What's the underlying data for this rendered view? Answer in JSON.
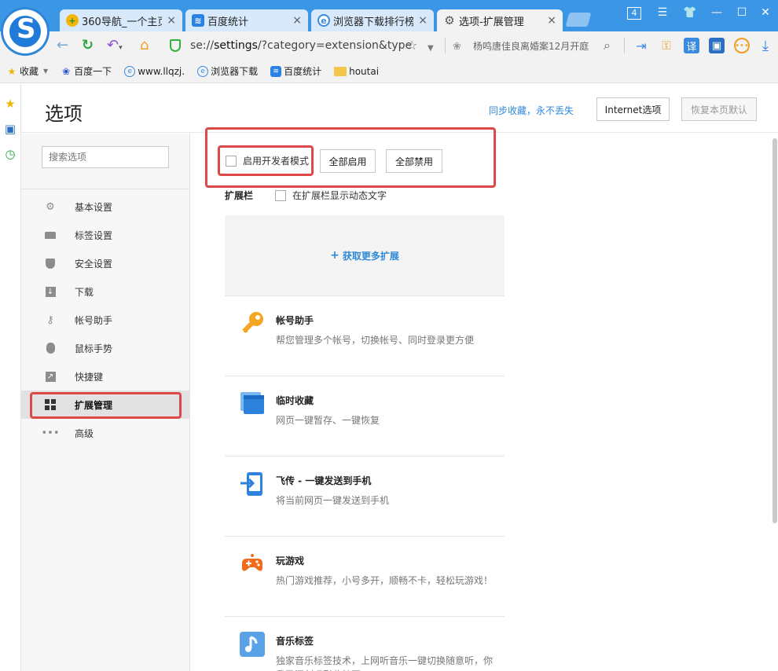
{
  "tabs": [
    {
      "label": "360导航_一个主页",
      "icon": "360-nav-icon",
      "close": "×"
    },
    {
      "label": "百度统计",
      "icon": "baidu-stats-icon",
      "close": "×"
    },
    {
      "label": "浏览器下载排行榜",
      "icon": "browser-download-icon",
      "close": "×"
    },
    {
      "label": "选项-扩展管理",
      "icon": "gear-icon",
      "close": "×"
    }
  ],
  "window": {
    "tab_count": "4"
  },
  "address": {
    "prefix": "se://",
    "bold": "settings",
    "rest": "/?category=extension&type"
  },
  "search_hint": "杨鸣唐佳良离婚案12月开庭",
  "bookmarks": [
    {
      "label": "收藏",
      "icon": "star-icon"
    },
    {
      "label": "百度一下",
      "icon": "baidu-paw-icon"
    },
    {
      "label": "www.llqzj.",
      "icon": "ie-icon"
    },
    {
      "label": "浏览器下载",
      "icon": "ie-icon"
    },
    {
      "label": "百度统计",
      "icon": "baidu-stats-icon"
    },
    {
      "label": "houtai",
      "icon": "folder-icon"
    }
  ],
  "page": {
    "title": "选项",
    "sync_link": "同步收藏，永不丢失",
    "internet_options": "Internet选项",
    "restore_default": "恢复本页默认"
  },
  "sidebar": {
    "search_placeholder": "搜索选项",
    "items": [
      {
        "label": "基本设置",
        "icon": "gear-icon"
      },
      {
        "label": "标签设置",
        "icon": "tab-icon"
      },
      {
        "label": "安全设置",
        "icon": "shield-icon"
      },
      {
        "label": "下载",
        "icon": "download-icon"
      },
      {
        "label": "帐号助手",
        "icon": "key-icon"
      },
      {
        "label": "鼠标手势",
        "icon": "mouse-icon"
      },
      {
        "label": "快捷键",
        "icon": "shortcut-arrow-icon"
      },
      {
        "label": "扩展管理",
        "icon": "grid-icon"
      },
      {
        "label": "高级",
        "icon": "more-dots-icon"
      }
    ]
  },
  "extensions_page": {
    "dev_mode": "启用开发者模式",
    "enable_all": "全部启用",
    "disable_all": "全部禁用",
    "bar_label": "扩展栏",
    "bar_dynamic_text": "在扩展栏显示动态文字",
    "get_more": "获取更多扩展",
    "items": [
      {
        "name": "帐号助手",
        "desc": "帮您管理多个帐号，切换帐号、同时登录更方便",
        "icon": "key-icon"
      },
      {
        "name": "临时收藏",
        "desc": "网页一键暂存、一键恢复",
        "icon": "window-stack-icon"
      },
      {
        "name": "飞传 - 一键发送到手机",
        "desc": "将当前网页一键发送到手机",
        "icon": "phone-send-icon"
      },
      {
        "name": "玩游戏",
        "desc": "热门游戏推荐，小号多开，顺畅不卡，轻松玩游戏！",
        "icon": "gamepad-icon"
      },
      {
        "name": "音乐标签",
        "desc": "独家音乐标签技术，上网听音乐一键切换随意听，你我已深刻吸引此特写",
        "icon": "music-note-icon"
      }
    ]
  }
}
